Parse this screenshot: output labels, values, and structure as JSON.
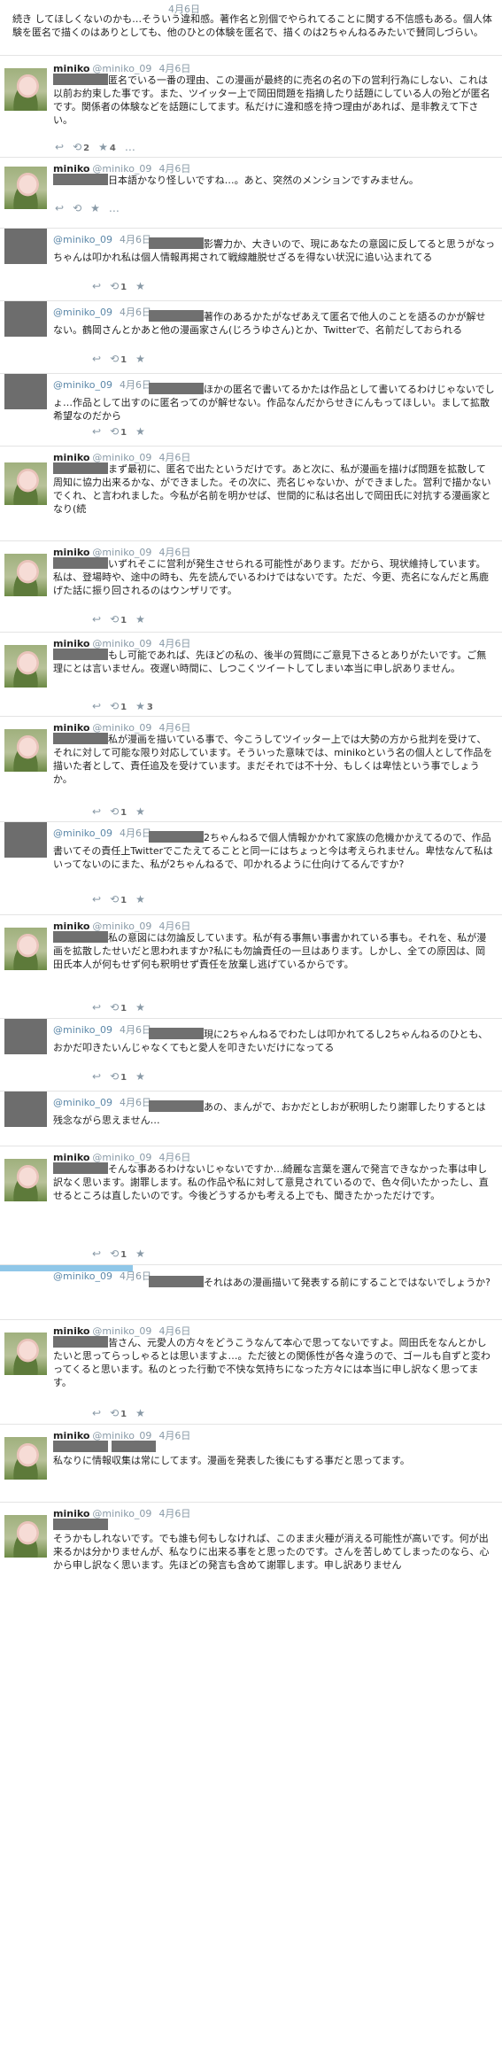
{
  "tweets": [
    {
      "variant": "date-only",
      "date": "4月6日",
      "text": "続き してほしくないのかも…そういう違和感。著作名と別個でやられてることに関する不信感もある。個人体験を匿名で描くのはありとしても、他のひとの体験を匿名で、描くのは2ちゃんねるみたいで賛同しづらい。"
    },
    {
      "variant": "pig",
      "name": "miniko",
      "handle": "@miniko_09",
      "date": "4月6日",
      "text": "匿名でいる一番の理由、この漫画が最終的に売名の名の下の営利行為にしない、これは以前お約束した事です。また、ツイッター上で岡田問題を指摘したり話題にしている人の殆どが匿名です。関係者の体験などを話題にしてます。私だけに違和感を持つ理由があれば、是非教えて下さい。",
      "retweets": "2",
      "favorites": "4"
    },
    {
      "variant": "pig",
      "name": "miniko",
      "handle": "@miniko_09",
      "date": "4月6日",
      "text": "日本語かなり怪しいですね…。あと、突然のメンションですみません。"
    },
    {
      "variant": "grey",
      "handle": "@miniko_09",
      "date": "4月6日",
      "text": "影響力か、大きいので、現にあなたの意図に反してると思うがなっちゃんは叩かれ私は個人情報再掲されて戦線離脱せざるを得ない状況に追い込まれてる",
      "retweets": "1"
    },
    {
      "variant": "grey",
      "handle": "@miniko_09",
      "date": "4月6日",
      "text": "著作のあるかたがなぜあえて匿名で他人のことを語るのかが解せない。鶴岡さんとかあと他の漫画家さん(じろうゆさん)とか、Twitterで、名前だしておられる",
      "retweets": "1"
    },
    {
      "variant": "grey",
      "handle": "@miniko_09",
      "date": "4月6日",
      "text": "ほかの匿名で書いてるかたは作品として書いてるわけじゃないでしょ…作品として出すのに匿名ってのが解せない。作品なんだからせきにんもってほしい。まして拡散希望なのだから",
      "retweets": "1"
    },
    {
      "variant": "pig",
      "name": "miniko",
      "handle": "@miniko_09",
      "date": "4月6日",
      "text": "まず最初に、匿名で出たというだけです。あと次に、私が漫画を描けば問題を拡散して周知に協力出来るかな、ができました。その次に、売名じゃないか、ができました。営利で描かないでくれ、と言われました。今私が名前を明かせば、世間的に私は名出しで岡田氏に対抗する漫画家となり(続"
    },
    {
      "variant": "pig",
      "name": "miniko",
      "handle": "@miniko_09",
      "date": "4月6日",
      "text": "いずれそこに営利が発生させられる可能性があります。だから、現状維持しています。私は、登場時や、途中の時も、先を読んでいるわけではないです。ただ、今更、売名になんだと馬鹿げた話に振り回されるのはウンザリです。",
      "retweets": "1"
    },
    {
      "variant": "pig",
      "name": "miniko",
      "handle": "@miniko_09",
      "date": "4月6日",
      "text": "もし可能であれば、先ほどの私の、後半の質問にご意見下さるとありがたいです。ご無理にとは言いません。夜遅い時間に、しつこくツイートしてしまい本当に申し訳ありません。",
      "retweets": "1",
      "favorites": "3"
    },
    {
      "variant": "pig",
      "name": "miniko",
      "handle": "@miniko_09",
      "date": "4月6日",
      "text": "私が漫画を描いている事で、今こうしてツイッター上では大勢の方から批判を受けて、それに対して可能な限り対応しています。そういった意味では、minikoという名の個人として作品を描いた者として、責任追及を受けています。まだそれでは不十分、もしくは卑怯という事でしょうか。",
      "retweets": "1"
    },
    {
      "variant": "grey",
      "handle": "@miniko_09",
      "date": "4月6日",
      "text": "2ちゃんねるで個人情報かかれて家族の危機かかえてるので、作品書いてその責任上Twitterでこたえてることと同一にはちょっと今は考えられません。卑怯なんて私はいってないのにまた、私が2ちゃんねるで、叩かれるように仕向けてるんですか?",
      "retweets": "1"
    },
    {
      "variant": "pig",
      "name": "miniko",
      "handle": "@miniko_09",
      "date": "4月6日",
      "text": "私の意図には勿論反しています。私が有る事無い事書かれている事も。それを、私が漫画を拡散したせいだと思われますか?私にも勿論責任の一旦はあります。しかし、全ての原因は、岡田氏本人が何もせず何も釈明せず責任を放棄し逃げているからです。",
      "retweets": "1"
    },
    {
      "variant": "grey",
      "handle": "@miniko_09",
      "date": "4月6日",
      "text": "現に2ちゃんねるでわたしは叩かれてるし2ちゃんねるのひとも、おかだ叩きたいんじゃなくてもと愛人を叩きたいだけになってる",
      "retweets": "1"
    },
    {
      "variant": "grey-short",
      "handle": "@miniko_09",
      "date": "4月6日",
      "text": "あの、まんがで、おかだとしおが釈明したり謝罪したりするとは残念ながら思えません…"
    },
    {
      "variant": "pig",
      "name": "miniko",
      "handle": "@miniko_09",
      "date": "4月6日",
      "text": "そんな事あるわけないじゃないですか…綺麗な言葉を選んで発言できなかった事は申し訳なく思います。謝罪します。私の作品や私に対して意見されているので、色々伺いたかったし、直せるところは直したいのです。今後どうするかも考える上でも、聞きたかっただけです。",
      "retweets": "1"
    },
    {
      "variant": "blue",
      "handle": "@miniko_09",
      "date": "4月6日",
      "text": "それはあの漫画描いて発表する前にすることではないでしょうか?"
    },
    {
      "variant": "pig",
      "name": "miniko",
      "handle": "@miniko_09",
      "date": "4月6日",
      "text": "皆さん、元愛人の方々をどうこうなんて本心で思ってないですよ。岡田氏をなんとかしたいと思ってらっしゃるとは思いますよ…。ただ彼との関係性が各々違うので、ゴールも自ずと変わってくると思います。私のとった行動で不快な気持ちになった方々には本当に申し訳なく思ってます。",
      "retweets": "1"
    },
    {
      "variant": "pig",
      "name": "miniko",
      "handle": "@miniko_09",
      "date": "4月6日",
      "text": "私なりに情報収集は常にしてます。漫画を発表した後にもする事だと思ってます。"
    },
    {
      "variant": "pig",
      "name": "miniko",
      "handle": "@miniko_09",
      "date": "4月6日",
      "text": "そうかもしれないです。でも誰も何もしなければ、このまま火種が消える可能性が高いです。何が出来るかは分かりませんが、私なりに出来る事をと思ったのです。さんを苦しめてしまったのなら、心から申し訳なく思います。先ほどの発言も含めて謝罪します。申し訳ありません"
    }
  ]
}
